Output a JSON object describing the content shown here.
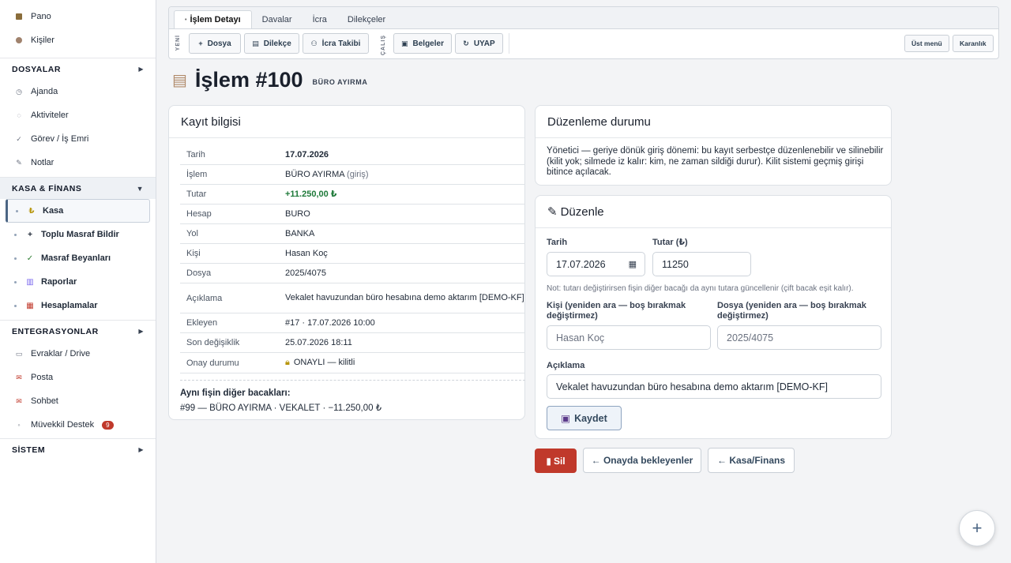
{
  "sidebar": {
    "top_items": [
      {
        "label": "Pano",
        "icon": "dashboard-icon"
      },
      {
        "label": "Kişiler",
        "icon": "people-icon"
      }
    ],
    "dosyalar": {
      "label": "DOSYALAR",
      "items": [
        {
          "label": "Ajanda",
          "icon": "clock-icon"
        },
        {
          "label": "Aktiviteler",
          "icon": "activity-icon"
        },
        {
          "label": "Görev / İş Emri",
          "icon": "check-icon"
        },
        {
          "label": "Notlar",
          "icon": "pencil-icon"
        }
      ]
    },
    "kasa": {
      "label": "KASA & FİNANS",
      "items": [
        {
          "label": "Kasa",
          "icon": "lira-icon"
        },
        {
          "label": "Toplu Masraf Bildir",
          "icon": "plus-icon"
        },
        {
          "label": "Masraf Beyanları",
          "icon": "check-icon"
        },
        {
          "label": "Raporlar",
          "icon": "chart-icon"
        },
        {
          "label": "Hesaplamalar",
          "icon": "calculator-icon"
        }
      ]
    },
    "entegrasyonlar": {
      "label": "ENTEGRASYONLAR",
      "items": [
        {
          "label": "Evraklar / Drive",
          "icon": "folder-icon"
        },
        {
          "label": "Posta",
          "icon": "mail-icon"
        },
        {
          "label": "Sohbet",
          "icon": "chat-icon"
        },
        {
          "label": "Müvekkil Destek",
          "icon": "support-icon",
          "badge": "9"
        }
      ]
    },
    "sistem": {
      "label": "SİSTEM"
    }
  },
  "toolbar": {
    "tabs": [
      "İşlem Detayı",
      "Davalar",
      "İcra",
      "Dilekçeler"
    ],
    "group_yeni": "YENİ",
    "group_calis": "ÇALIŞ",
    "buttons": {
      "dosya": "Dosya",
      "dilekce": "Dilekçe",
      "icra_takibi": "İcra Takibi",
      "belgeler": "Belgeler",
      "uyap": "UYAP",
      "ust_menu": "Üst menü",
      "karanlik": "Karanlık"
    }
  },
  "page": {
    "title": "İşlem #100",
    "tag": "BÜRO AYIRMA"
  },
  "record": {
    "title": "Kayıt bilgisi",
    "rows": [
      {
        "key": "Tarih",
        "value": "17.07.2026"
      },
      {
        "key": "İşlem",
        "value": "BÜRO AYIRMA",
        "extra": "(giriş)"
      },
      {
        "key": "Tutar",
        "value": "+11.250,00 ₺"
      },
      {
        "key": "Hesap",
        "value": "BURO"
      },
      {
        "key": "Yol",
        "value": "BANKA"
      },
      {
        "key": "Kişi",
        "value": "Hasan Koç"
      },
      {
        "key": "Dosya",
        "value": "2025/4075"
      },
      {
        "key": "Açıklama",
        "value": "Vekalet havuzundan büro hesabına demo aktarım [DEMO-KF]"
      },
      {
        "key": "Ekleyen",
        "value": "#17 · 17.07.2026 10:00"
      },
      {
        "key": "Son değişiklik",
        "value": "25.07.2026 18:11"
      },
      {
        "key": "Onay durumu",
        "value": "ONAYLI — kilitli"
      }
    ],
    "other_legs_title": "Aynı fişin diğer bacakları:",
    "other_legs_value": "#99 — BÜRO AYIRMA · VEKALET · −11.250,00 ₺"
  },
  "edit_status": {
    "title": "Düzenleme durumu",
    "text": "Yönetici — geriye dönük giriş dönemi: bu kayıt serbestçe düzenlenebilir ve silinebilir (kilit yok; silmede iz kalır: kim, ne zaman sildiği durur). Kilit sistemi geçmiş girişi bitince açılacak."
  },
  "edit": {
    "title": "Düzenle",
    "date_label": "Tarih",
    "date_value": "17.07.2026",
    "amount_label": "Tutar (₺)",
    "amount_value": "11250",
    "note": "Not: tutarı değiştirirsen fişin diğer bacağı da aynı tutara güncellenir (çift bacak eşit kalır).",
    "person_label": "Kişi (yeniden ara — boş bırakmak değiştirmez)",
    "person_placeholder": "Hasan Koç",
    "file_label": "Dosya (yeniden ara — boş bırakmak değiştirmez)",
    "file_placeholder": "2025/4075",
    "desc_label": "Açıklama",
    "desc_value": "Vekalet havuzundan büro hesabına demo aktarım [DEMO-KF]",
    "save_label": "Kaydet"
  },
  "actions": {
    "delete": "Sil",
    "pending": "← Onayda bekleyenler",
    "kasa": "← Kasa/Finans"
  },
  "colors": {
    "accent": "#4b6584",
    "danger": "#c0392b",
    "positive": "#1f7a3a"
  }
}
